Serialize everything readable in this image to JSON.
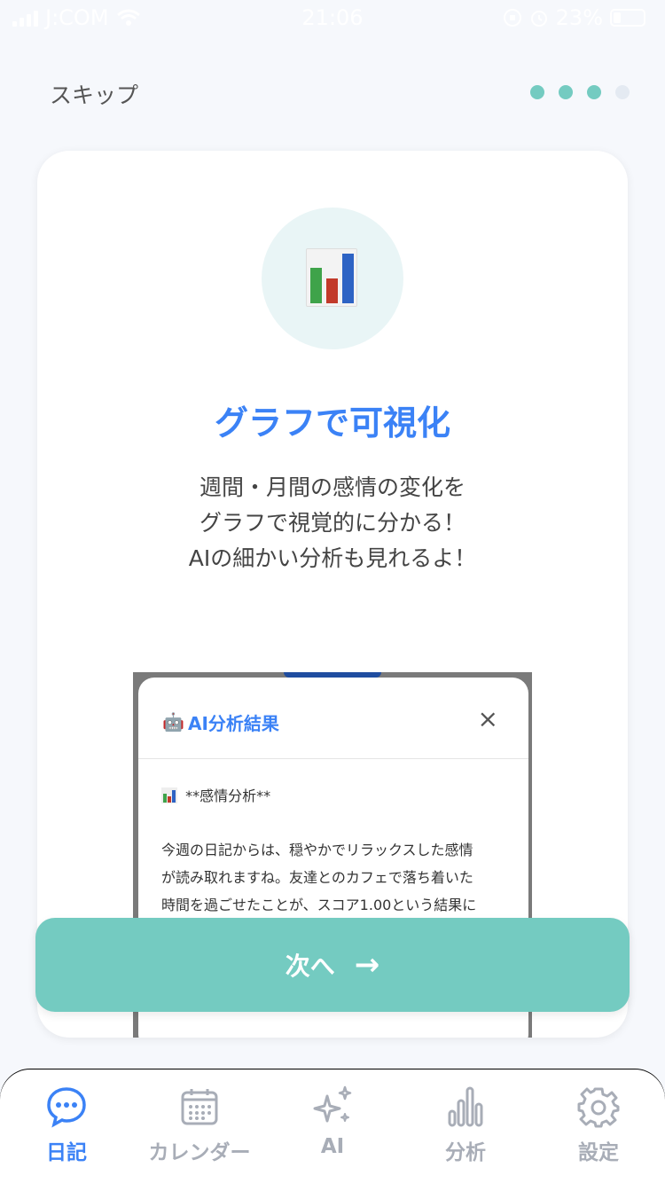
{
  "status_bar": {
    "carrier": "J:COM",
    "time": "21:06",
    "battery": "23%"
  },
  "header": {
    "skip_label": "スキップ",
    "page_indicator": {
      "total": 4,
      "current": 3
    }
  },
  "card": {
    "icon": "bar-chart-icon",
    "title": "グラフで可視化",
    "description_lines": [
      "週間・月間の感情の変化を",
      "グラフで視覚的に分かる！",
      "AIの細かい分析も見れるよ！"
    ]
  },
  "preview_modal": {
    "title": "AI分析結果",
    "close": "×",
    "section_heading": "**感情分析**",
    "body_lines": [
      "今週の日記からは、穏やかでリラックスした感情",
      "が読み取れますね。友達とのカフェで落ち着いた",
      "時間を過ごせたことが、スコア1.00という結果に"
    ]
  },
  "next_button": {
    "label": "次へ",
    "arrow": "→"
  },
  "tabbar": {
    "items": [
      {
        "label": "日記",
        "icon": "chat-bubble-icon",
        "active": true
      },
      {
        "label": "カレンダー",
        "icon": "calendar-icon",
        "active": false
      },
      {
        "label": "AI",
        "icon": "sparkles-icon",
        "active": false
      },
      {
        "label": "分析",
        "icon": "bar-chart-icon",
        "active": false
      },
      {
        "label": "設定",
        "icon": "gear-icon",
        "active": false
      }
    ]
  },
  "colors": {
    "accent": "#74cbc1",
    "primary": "#3b82f6",
    "inactive": "#a8adb7"
  }
}
